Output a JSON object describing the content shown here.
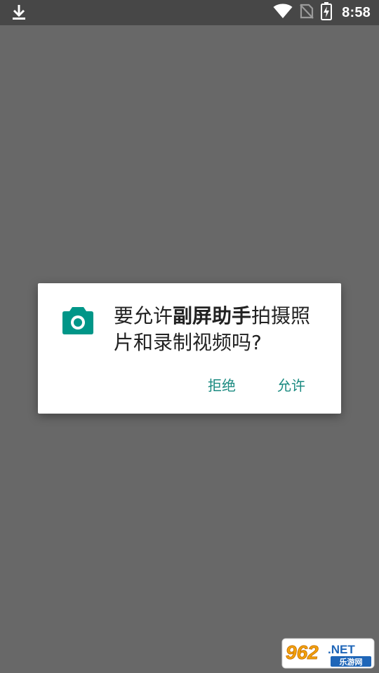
{
  "status_bar": {
    "time": "8:58",
    "left_icon": "download-icon",
    "right_icons": [
      "wifi-icon",
      "no-sim-icon",
      "battery-charging-icon"
    ]
  },
  "dialog": {
    "icon": "camera-icon",
    "icon_color": "#009688",
    "message_prefix": "要允许",
    "app_name": "副屏助手",
    "message_suffix": "拍摄照片和录制视频吗?",
    "deny_label": "拒绝",
    "allow_label": "允许",
    "button_color": "#1a8a80"
  },
  "watermark": {
    "logo_text": "962.NET",
    "sub_text": "乐游网"
  },
  "colors": {
    "scrim": "#686868",
    "status_bar": "#474747"
  }
}
